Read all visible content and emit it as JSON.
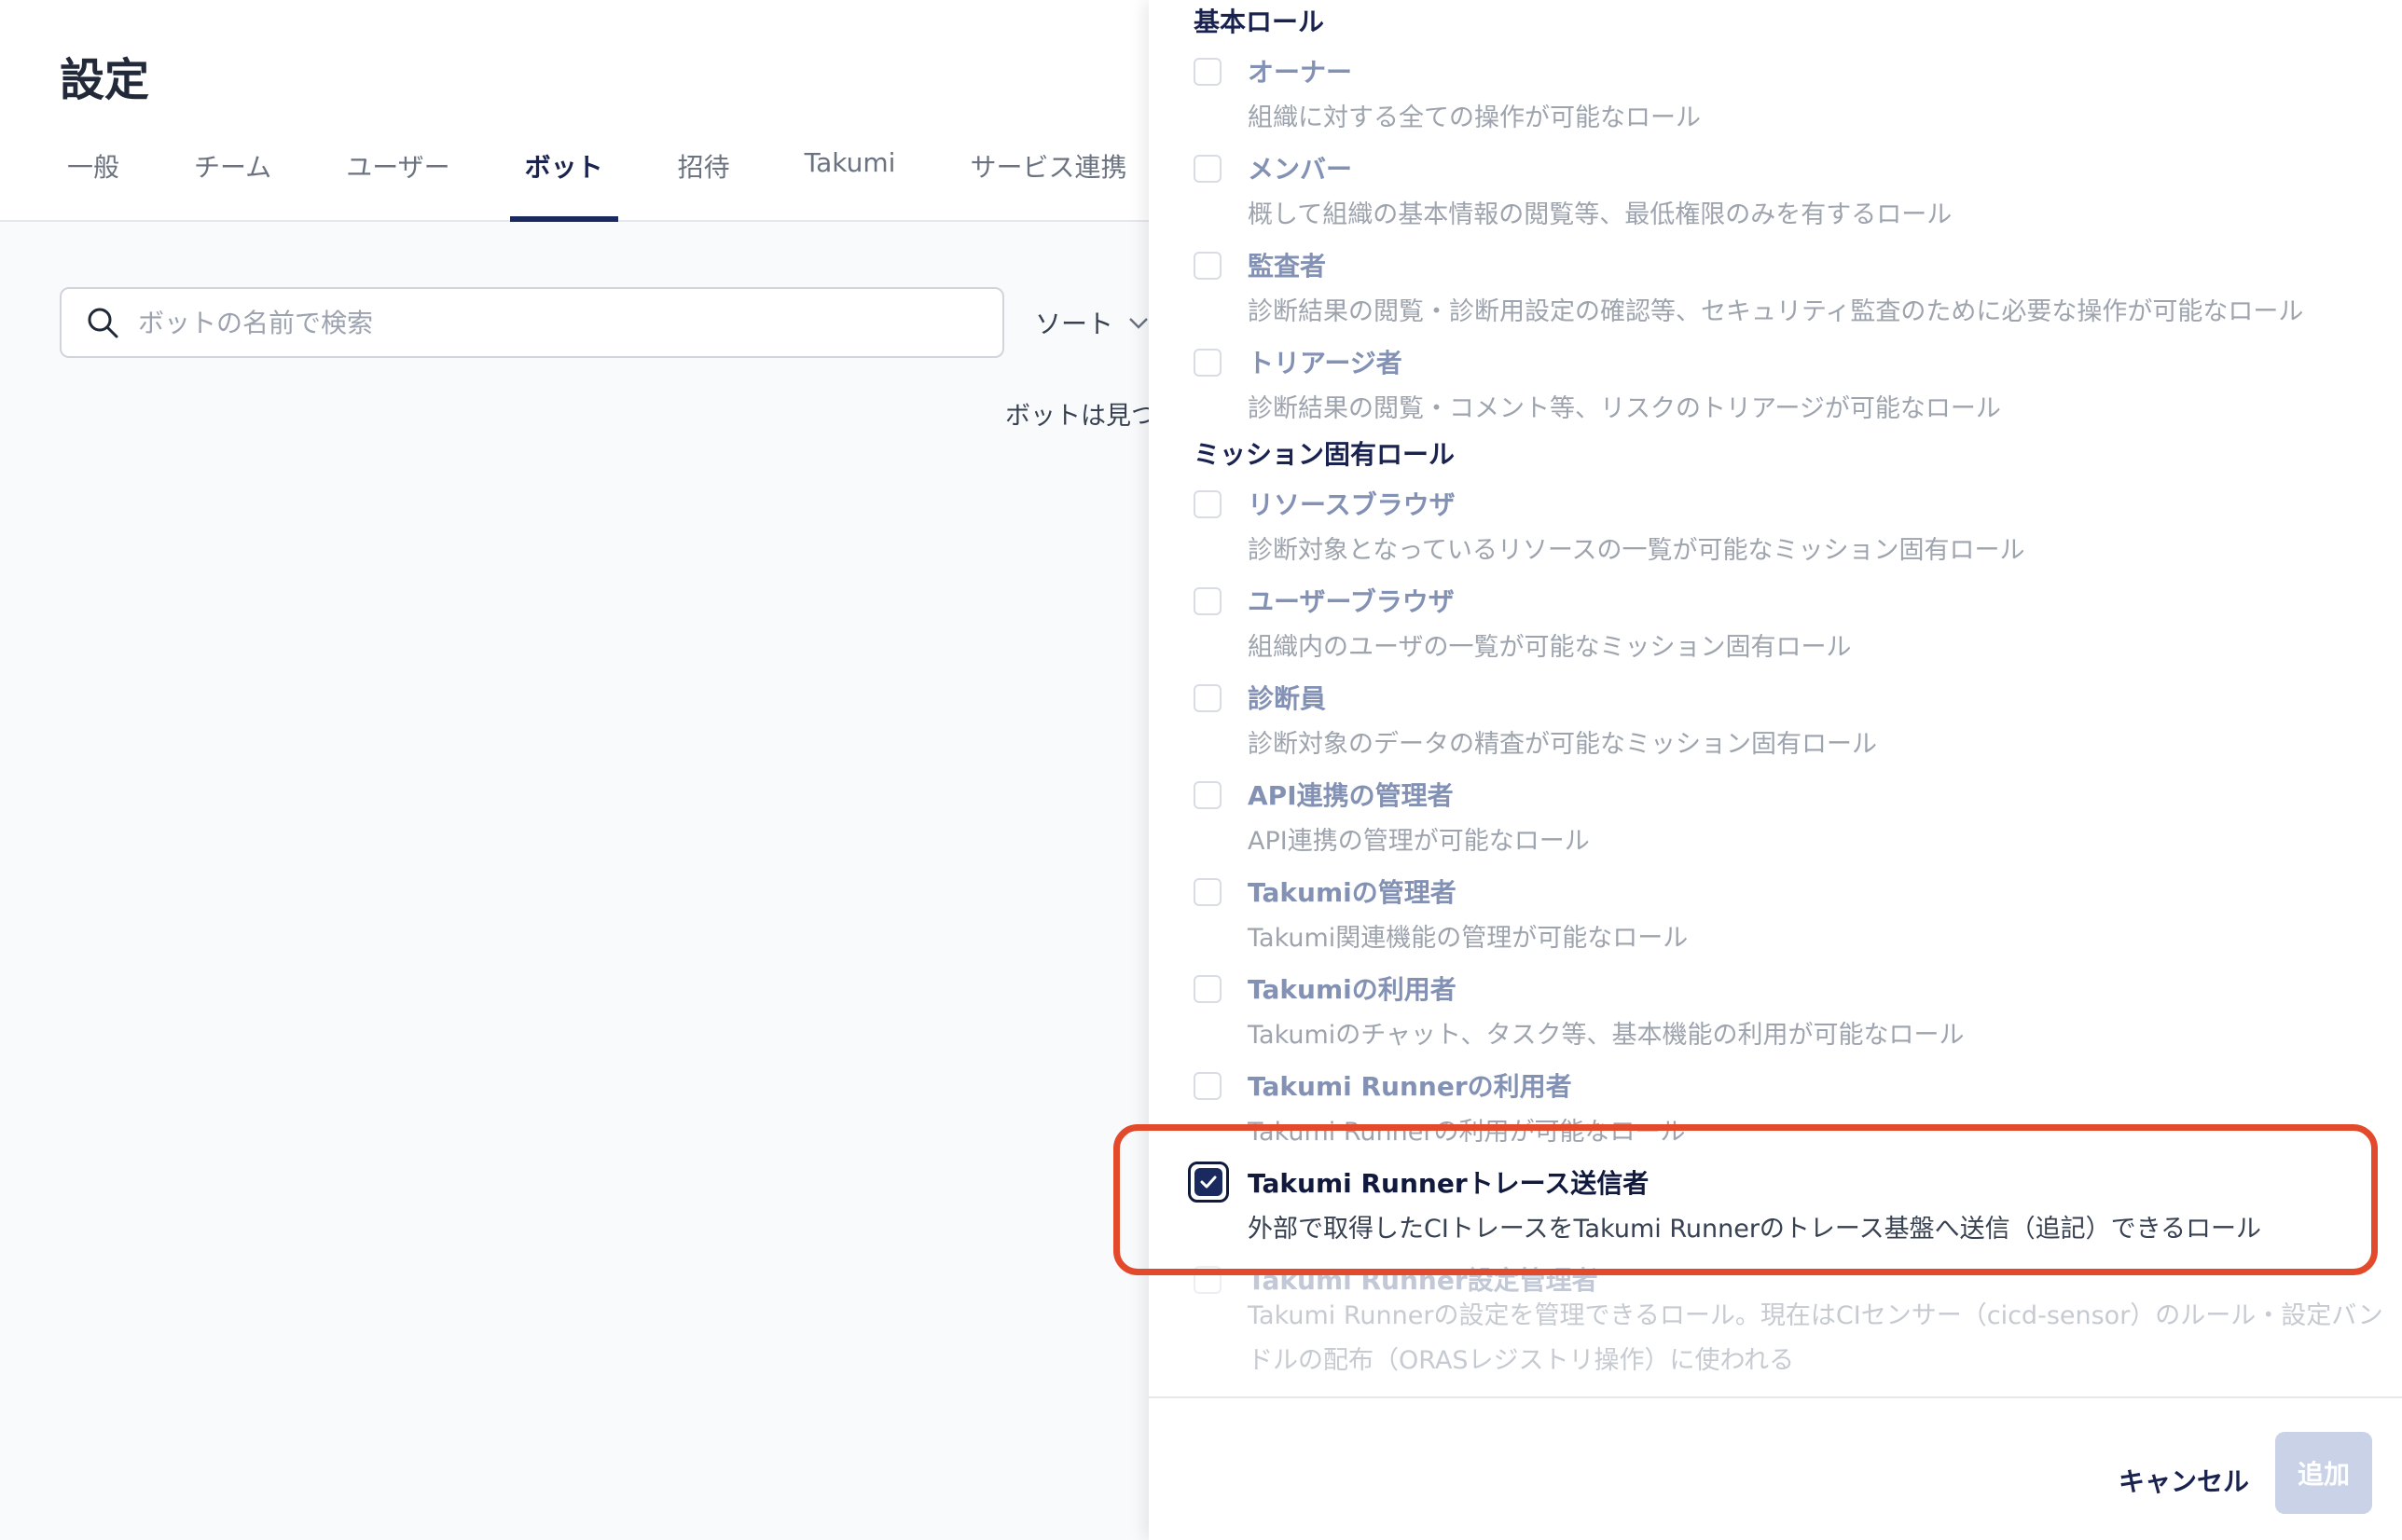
{
  "page": {
    "title": "設定",
    "tabs": [
      {
        "label": "一般",
        "active": false
      },
      {
        "label": "チーム",
        "active": false
      },
      {
        "label": "ユーザー",
        "active": false
      },
      {
        "label": "ボット",
        "active": true
      },
      {
        "label": "招待",
        "active": false
      },
      {
        "label": "Takumi",
        "active": false
      },
      {
        "label": "サービス連携",
        "active": false
      }
    ],
    "search": {
      "placeholder": "ボットの名前で検索",
      "value": ""
    },
    "sort_label": "ソート",
    "empty_message": "ボットは見つ"
  },
  "drawer": {
    "basic_roles_title": "基本ロール",
    "basic_roles": [
      {
        "name": "オーナー",
        "description": "組織に対する全ての操作が可能なロール",
        "checked": false
      },
      {
        "name": "メンバー",
        "description": "概して組織の基本情報の閲覧等、最低権限のみを有するロール",
        "checked": false
      },
      {
        "name": "監査者",
        "description": "診断結果の閲覧・診断用設定の確認等、セキュリティ監査のために必要な操作が可能なロール",
        "checked": false
      },
      {
        "name": "トリアージ者",
        "description": "診断結果の閲覧・コメント等、リスクのトリアージが可能なロール",
        "checked": false
      }
    ],
    "mission_roles_title": "ミッション固有ロール",
    "mission_roles": [
      {
        "name": "リソースブラウザ",
        "description": "診断対象となっているリソースの一覧が可能なミッション固有ロール",
        "checked": false
      },
      {
        "name": "ユーザーブラウザ",
        "description": "組織内のユーザの一覧が可能なミッション固有ロール",
        "checked": false
      },
      {
        "name": "診断員",
        "description": "診断対象のデータの精査が可能なミッション固有ロール",
        "checked": false
      },
      {
        "name": "API連携の管理者",
        "description": "API連携の管理が可能なロール",
        "checked": false
      },
      {
        "name": "Takumiの管理者",
        "description": "Takumi関連機能の管理が可能なロール",
        "checked": false
      },
      {
        "name": "Takumiの利用者",
        "description": "Takumiのチャット、タスク等、基本機能の利用が可能なロール",
        "checked": false
      },
      {
        "name": "Takumi Runnerの利用者",
        "description": "Takumi Runnerの利用が可能なロール",
        "checked": false
      },
      {
        "name": "Takumi Runnerトレース送信者",
        "description": "外部で取得したCIトレースをTakumi Runnerのトレース基盤へ送信（追記）できるロール",
        "checked": true
      },
      {
        "name": "Takumi Runner設定管理者",
        "description": "Takumi Runnerの設定を管理できるロール。現在はCIセンサー（cicd-sensor）のルール・設定バンドルの配布（ORASレジストリ操作）に使われる",
        "checked": false
      }
    ],
    "cancel_label": "キャンセル",
    "add_label": "追加"
  },
  "colors": {
    "accent": "#1a2a5e",
    "highlight": "#e24a2b"
  }
}
